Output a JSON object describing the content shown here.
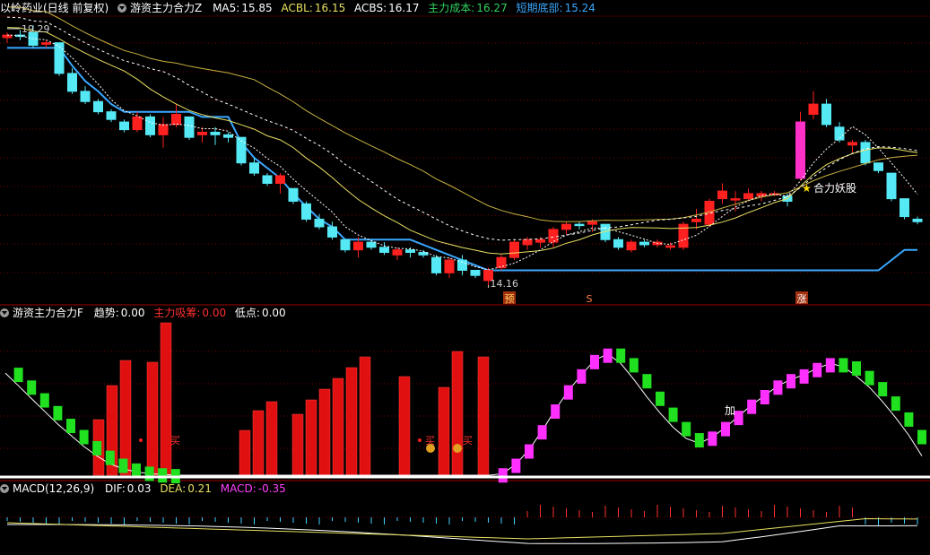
{
  "header_main": {
    "stock": "以岭药业(日线 前复权)",
    "indicator": "游资主力合力Z",
    "ma5_label": "MA5:",
    "ma5_value": "15.85",
    "acbl_label": "ACBL:",
    "acbl_value": "16.15",
    "acbs_label": "ACBS:",
    "acbs_value": "16.17",
    "cost_label": "主力成本:",
    "cost_value": "16.27",
    "bottom_label": "短期底部:",
    "bottom_value": "15.24"
  },
  "header_f": {
    "indicator": "游资主力合力F",
    "trend_label": "趋势:",
    "trend_value": "0.00",
    "absorb_label": "主力吸筹:",
    "absorb_value": "0.00",
    "low_label": "低点:",
    "low_value": "0.00"
  },
  "header_macd": {
    "indicator": "MACD(12,26,9)",
    "dif_label": "DIF:",
    "dif_value": "0.03",
    "dea_label": "DEA:",
    "dea_value": "0.21",
    "macd_label": "MACD:",
    "macd_value": "-0.35"
  },
  "annotations": {
    "high_label": "19.29",
    "low_label": "14.16",
    "sig_yu": "预",
    "sig_s": "S",
    "sig_zhang": "涨",
    "star_text": "合力妖股",
    "buy1": "买",
    "buy2": "买",
    "buy3": "买",
    "jia": "加"
  },
  "colors": {
    "up": "#ff2020",
    "down": "#55e8f5",
    "bg": "#000000",
    "grid": "#7a0000",
    "ma5": "#e8e8e8",
    "acbl": "#e8e060",
    "acbs": "#ffffff",
    "cost": "#30d060",
    "bottom": "#3aa8ff",
    "trend_up": "#ff30ff",
    "trend_down": "#20e020"
  },
  "chart_data": [
    {
      "type": "candlestick",
      "title": "游资主力合力Z",
      "series": [
        {
          "name": "K",
          "ohlc": [
            [
              19.05,
              19.15,
              18.95,
              19.1
            ],
            [
              19.1,
              19.2,
              19.0,
              19.08
            ],
            [
              19.15,
              19.29,
              18.85,
              18.9
            ],
            [
              18.92,
              19.0,
              18.85,
              18.95
            ],
            [
              18.95,
              18.95,
              18.3,
              18.35
            ],
            [
              18.35,
              18.45,
              17.95,
              18.0
            ],
            [
              18.0,
              18.1,
              17.75,
              17.8
            ],
            [
              17.8,
              17.85,
              17.55,
              17.6
            ],
            [
              17.6,
              17.65,
              17.4,
              17.45
            ],
            [
              17.4,
              17.45,
              17.2,
              17.25
            ],
            [
              17.25,
              17.6,
              17.2,
              17.5
            ],
            [
              17.5,
              17.55,
              17.1,
              17.15
            ],
            [
              17.15,
              17.5,
              16.9,
              17.35
            ],
            [
              17.35,
              17.75,
              17.3,
              17.55
            ],
            [
              17.5,
              17.5,
              17.05,
              17.1
            ],
            [
              17.15,
              17.3,
              17.0,
              17.2
            ],
            [
              17.2,
              17.3,
              16.95,
              17.15
            ],
            [
              17.15,
              17.2,
              17.0,
              17.1
            ],
            [
              17.1,
              17.1,
              16.55,
              16.6
            ],
            [
              16.6,
              16.7,
              16.35,
              16.4
            ],
            [
              16.35,
              16.4,
              16.15,
              16.2
            ],
            [
              16.2,
              16.4,
              16.0,
              16.35
            ],
            [
              16.1,
              16.1,
              15.8,
              15.85
            ],
            [
              15.8,
              15.85,
              15.45,
              15.5
            ],
            [
              15.5,
              15.6,
              15.3,
              15.35
            ],
            [
              15.35,
              15.45,
              15.1,
              15.15
            ],
            [
              15.1,
              15.1,
              14.85,
              14.9
            ],
            [
              14.9,
              15.15,
              14.75,
              15.05
            ],
            [
              15.05,
              15.1,
              14.9,
              14.95
            ],
            [
              14.95,
              15.05,
              14.8,
              14.85
            ],
            [
              14.8,
              14.95,
              14.7,
              14.9
            ],
            [
              14.9,
              14.95,
              14.75,
              14.85
            ],
            [
              14.85,
              14.9,
              14.75,
              14.8
            ],
            [
              14.75,
              14.8,
              14.4,
              14.45
            ],
            [
              14.45,
              14.75,
              14.35,
              14.7
            ],
            [
              14.7,
              14.8,
              14.4,
              14.5
            ],
            [
              14.5,
              14.5,
              14.35,
              14.4
            ],
            [
              14.3,
              14.55,
              14.16,
              14.5
            ],
            [
              14.55,
              14.8,
              14.5,
              14.75
            ],
            [
              14.75,
              15.1,
              14.7,
              15.05
            ],
            [
              15.0,
              15.15,
              14.9,
              15.1
            ],
            [
              15.05,
              15.15,
              14.95,
              15.1
            ],
            [
              15.05,
              15.35,
              14.95,
              15.3
            ],
            [
              15.3,
              15.45,
              15.2,
              15.4
            ],
            [
              15.4,
              15.45,
              15.3,
              15.38
            ],
            [
              15.4,
              15.5,
              15.25,
              15.45
            ],
            [
              15.4,
              15.4,
              15.05,
              15.1
            ],
            [
              15.1,
              15.15,
              14.9,
              14.95
            ],
            [
              14.9,
              15.1,
              14.85,
              15.05
            ],
            [
              15.05,
              15.1,
              14.95,
              15.0
            ],
            [
              15.0,
              15.1,
              14.95,
              15.05
            ],
            [
              14.95,
              15.05,
              14.9,
              14.98
            ],
            [
              14.95,
              15.45,
              14.9,
              15.4
            ],
            [
              15.45,
              15.7,
              15.3,
              15.5
            ],
            [
              15.4,
              15.9,
              15.35,
              15.85
            ],
            [
              15.9,
              16.2,
              15.8,
              16.05
            ],
            [
              15.9,
              16.05,
              15.65,
              15.9
            ],
            [
              15.9,
              16.1,
              15.85,
              16.0
            ],
            [
              15.95,
              16.05,
              15.85,
              16.0
            ],
            [
              16.0,
              16.05,
              15.95,
              16.0
            ],
            [
              15.95,
              16.0,
              15.75,
              15.85
            ],
            [
              16.3,
              17.6,
              16.25,
              17.4
            ],
            [
              17.55,
              18.0,
              17.45,
              17.75
            ],
            [
              17.75,
              17.85,
              17.3,
              17.35
            ],
            [
              17.3,
              17.4,
              17.0,
              17.05
            ],
            [
              16.95,
              17.05,
              16.8,
              17.0
            ],
            [
              17.0,
              17.05,
              16.55,
              16.6
            ],
            [
              16.6,
              16.6,
              16.4,
              16.45
            ],
            [
              16.4,
              16.4,
              15.85,
              15.9
            ],
            [
              15.9,
              15.9,
              15.5,
              15.55
            ],
            [
              15.5,
              15.55,
              15.4,
              15.45
            ]
          ]
        },
        {
          "name": "MA5",
          "values": []
        },
        {
          "name": "ACBL",
          "values": []
        },
        {
          "name": "ACBS",
          "values": []
        },
        {
          "name": "短期底部",
          "values": [
            18.85,
            18.85,
            18.85,
            18.85,
            18.85,
            18.5,
            18.2,
            18.0,
            17.75,
            17.6,
            17.6,
            17.6,
            17.6,
            17.6,
            17.6,
            17.5,
            17.5,
            17.5,
            17.0,
            16.7,
            16.5,
            16.3,
            16.0,
            15.75,
            15.5,
            15.35,
            15.1,
            15.1,
            15.1,
            15.1,
            15.1,
            15.1,
            15.0,
            14.9,
            14.8,
            14.7,
            14.6,
            14.5,
            14.5,
            14.5,
            14.5,
            14.5,
            14.5,
            14.5,
            14.5,
            14.5,
            14.5,
            14.5,
            14.5,
            14.5,
            14.5,
            14.5,
            14.5,
            14.5,
            14.5,
            14.5,
            14.5,
            14.5,
            14.5,
            14.5,
            14.5,
            14.5,
            14.5,
            14.5,
            14.5,
            14.5,
            14.5,
            14.5,
            14.7,
            14.9,
            14.9
          ]
        }
      ],
      "ylim": [
        14.0,
        19.4
      ]
    },
    {
      "type": "bar",
      "title": "游资主力合力F",
      "series": [
        {
          "name": "主力吸筹",
          "values": [
            0,
            0,
            0,
            0,
            0,
            0,
            0,
            0,
            0,
            0,
            0,
            0,
            0,
            0,
            0,
            5.3,
            7.0,
            8.4,
            0,
            0,
            0,
            0,
            0,
            0,
            0,
            0,
            0,
            0,
            0,
            0,
            0,
            0,
            0,
            0,
            0,
            0,
            0,
            0,
            0,
            0,
            0,
            0,
            0,
            0,
            0,
            0,
            0,
            0,
            0,
            0,
            0,
            0,
            0,
            0,
            0,
            0,
            0,
            0,
            0,
            0,
            0,
            0,
            0,
            0,
            0,
            0,
            0,
            0,
            0,
            0,
            0
          ],
          "note": "bars placed at selected columns"
        },
        {
          "name": "趋势",
          "values": [
            6.4,
            5.6,
            4.8,
            4.0,
            3.2,
            2.5,
            1.8,
            1.2,
            0.7,
            0.4,
            0.2,
            0.1,
            0.05,
            0,
            0,
            0,
            0,
            0,
            0,
            0,
            0,
            0,
            0,
            0,
            0,
            0,
            0,
            0,
            0,
            0,
            0,
            0,
            0,
            0,
            0,
            0,
            0,
            0,
            0.1,
            0.7,
            1.6,
            2.8,
            4.1,
            5.3,
            6.3,
            7.2,
            7.6,
            7.0,
            6.0,
            4.9,
            3.9,
            3.0,
            2.3,
            2.0,
            2.4,
            3.0,
            3.7,
            4.4,
            5.0,
            5.6,
            6.0,
            6.3,
            6.7,
            7.0,
            6.8,
            6.2,
            5.5,
            4.6,
            3.6,
            2.5,
            1.2
          ]
        }
      ],
      "ylim": [
        0,
        10
      ]
    },
    {
      "type": "line",
      "title": "MACD(12,26,9)",
      "series": [
        {
          "name": "DIF",
          "values": [
            0.03
          ]
        },
        {
          "name": "DEA",
          "values": [
            0.21
          ]
        },
        {
          "name": "MACD",
          "values": [
            -0.35
          ]
        }
      ]
    }
  ]
}
